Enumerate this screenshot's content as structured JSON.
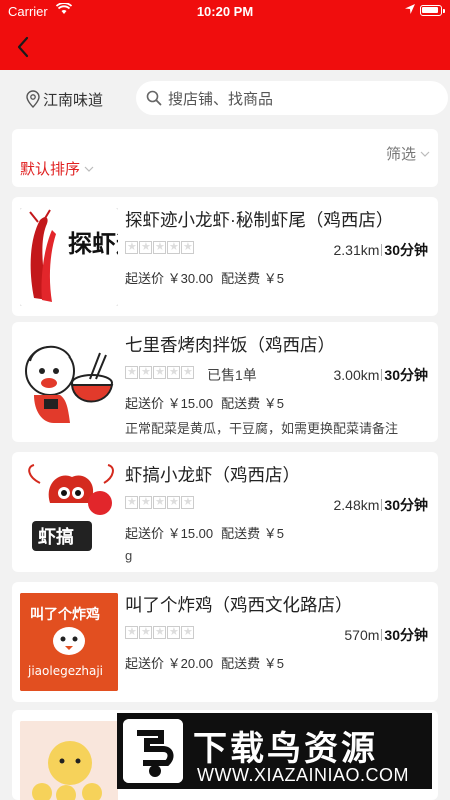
{
  "status_bar": {
    "carrier": "Carrier",
    "time": "10:20 PM"
  },
  "header": {
    "back_icon": "chevron-left-icon"
  },
  "location": {
    "city": "江南味道"
  },
  "search": {
    "placeholder": "搜店铺、找商品"
  },
  "sort": {
    "default_label": "默认排序",
    "filter_label": "筛选"
  },
  "shops": [
    {
      "name": "探虾迹小龙虾·秘制虾尾（鸡西店）",
      "sold": "",
      "distance": "2.31km",
      "time": "30分钟",
      "min_order": "起送价 ￥30.00",
      "delivery_fee": "配送费 ￥5",
      "note": "",
      "logo_text": "探虾迹"
    },
    {
      "name": "七里香烤肉拌饭（鸡西店）",
      "sold": "已售1单",
      "distance": "3.00km",
      "time": "30分钟",
      "min_order": "起送价 ￥15.00",
      "delivery_fee": "配送费 ￥5",
      "note": "正常配菜是黄瓜，干豆腐，如需更换配菜请备注",
      "logo_text": ""
    },
    {
      "name": "虾搞小龙虾（鸡西店）",
      "sold": "",
      "distance": "2.48km",
      "time": "30分钟",
      "min_order": "起送价 ￥15.00",
      "delivery_fee": "配送费 ￥5",
      "note": "g",
      "logo_text": "虾搞"
    },
    {
      "name": "叫了个炸鸡（鸡西文化路店）",
      "sold": "",
      "distance": "570m",
      "time": "30分钟",
      "min_order": "起送价 ￥20.00",
      "delivery_fee": "配送费 ￥5",
      "note": "",
      "logo_text": "叫了个炸鸡",
      "logo_sub": "jiaolegezhaji"
    },
    {
      "name": "",
      "sold": "",
      "distance": "",
      "time": "",
      "min_order": "",
      "delivery_fee": "",
      "note": "",
      "logo_text": ""
    }
  ],
  "watermark": {
    "title": "下载鸟资源",
    "url": "WWW.XIAZAINIAO.COM"
  },
  "colors": {
    "brand_red": "#f00d0d",
    "sort_red": "#e02020",
    "background": "#f2f2f2"
  }
}
